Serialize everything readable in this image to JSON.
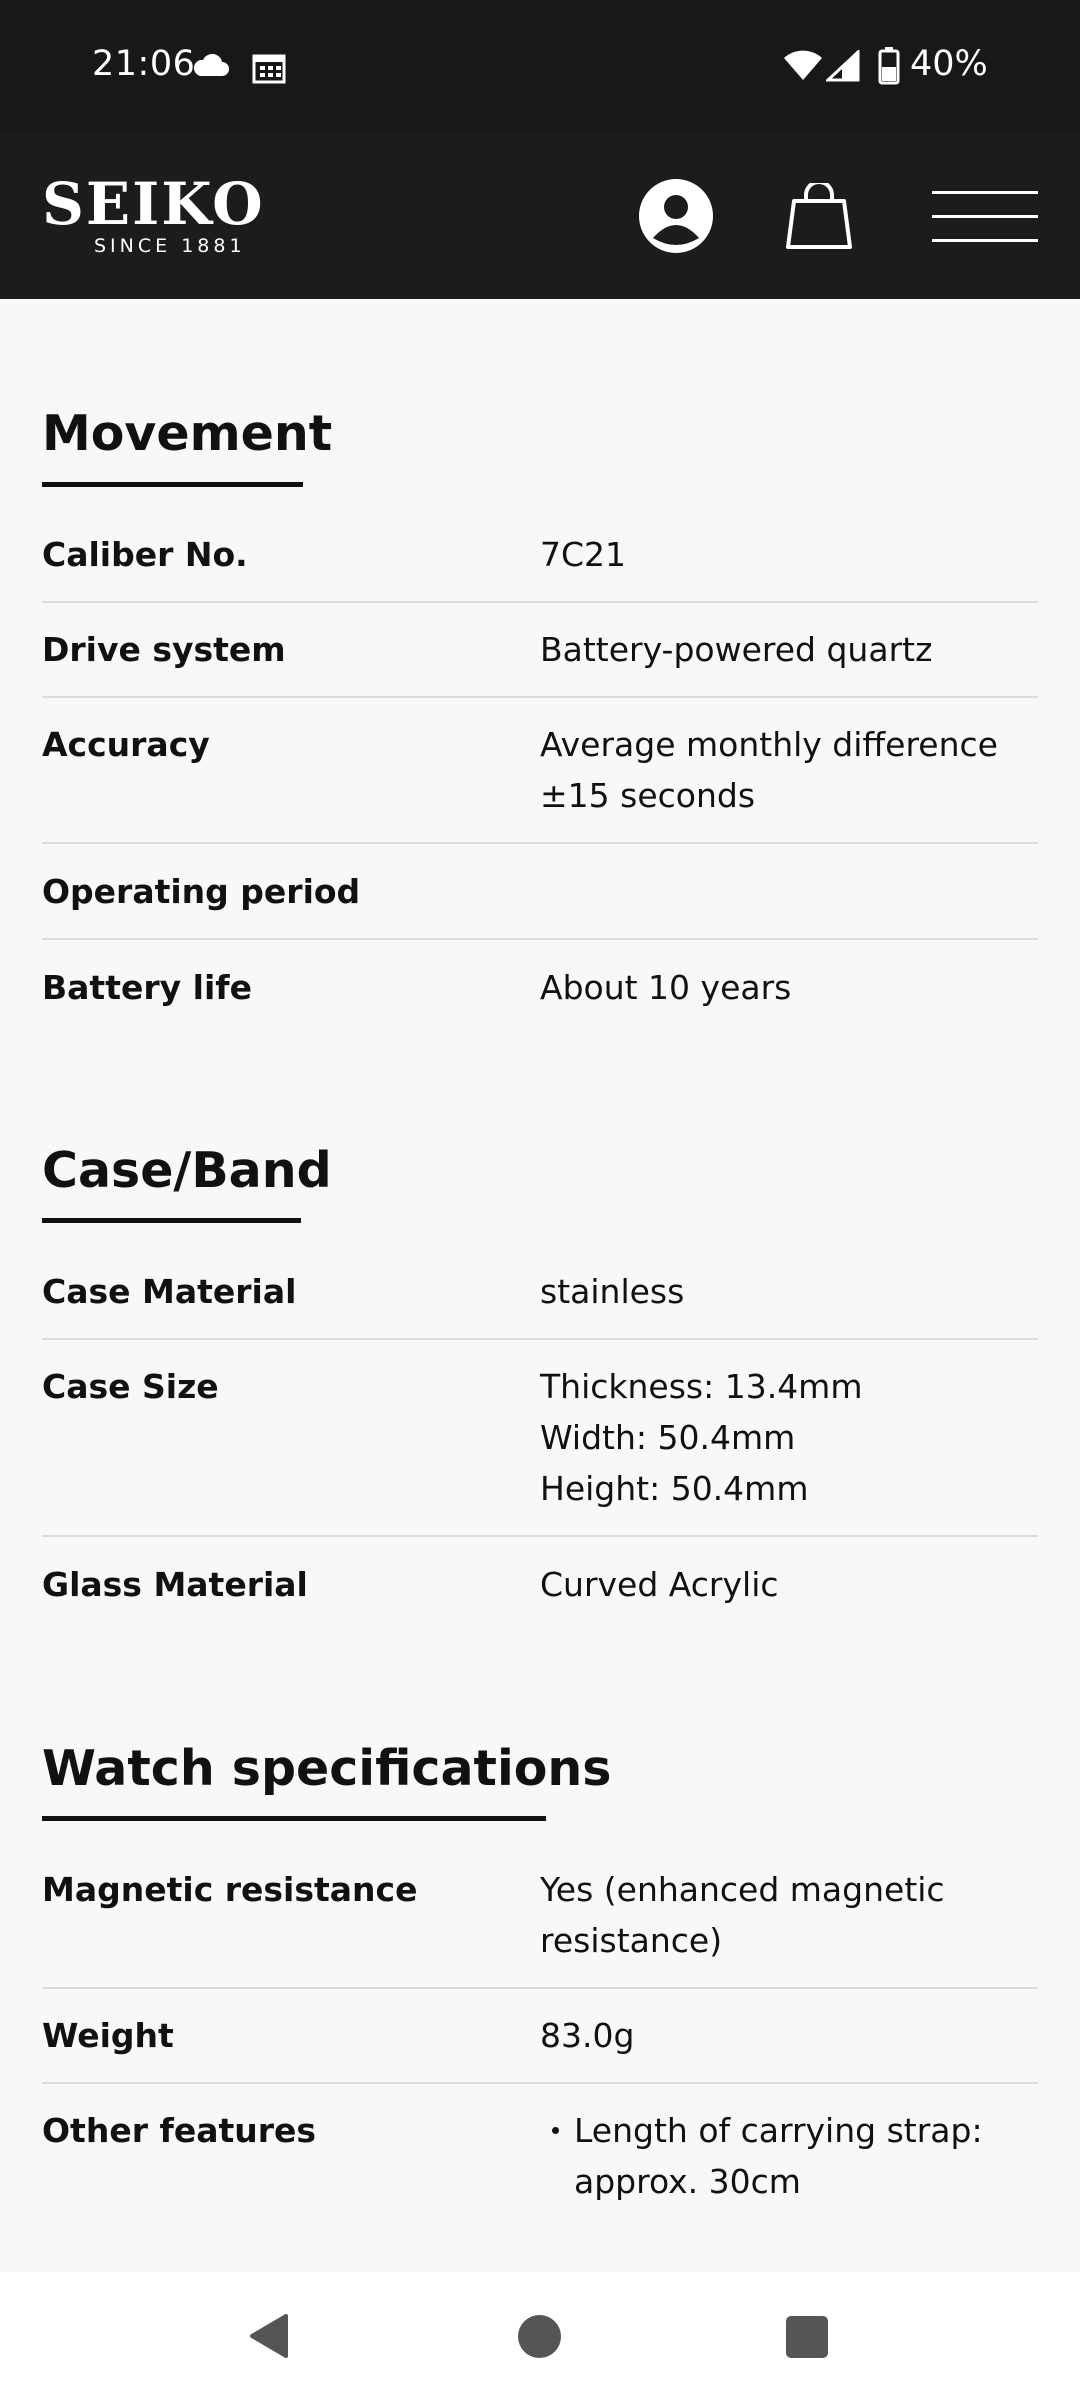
{
  "status_bar": {
    "time": "21:06",
    "battery_percent": "40%",
    "icons": [
      "cloud-icon",
      "calendar-icon",
      "wifi-icon",
      "signal-icon",
      "battery-icon"
    ]
  },
  "header": {
    "logo_text": "SEIKO",
    "logo_tagline": "SINCE 1881",
    "icons": [
      "account-icon",
      "shopping-bag-icon",
      "hamburger-menu-icon"
    ]
  },
  "sections": {
    "movement": {
      "title": "Movement",
      "rows": [
        {
          "label": "Caliber No.",
          "value": [
            "7C21"
          ]
        },
        {
          "label": "Drive system",
          "value": [
            "Battery-powered quartz"
          ]
        },
        {
          "label": "Accuracy",
          "value": [
            "Average monthly difference",
            "±15 seconds"
          ]
        },
        {
          "label": "Operating period",
          "value": []
        },
        {
          "label": "Battery life",
          "value": [
            "About 10 years"
          ]
        }
      ]
    },
    "case_band": {
      "title": "Case/Band",
      "rows": [
        {
          "label": "Case Material",
          "value": [
            "stainless"
          ]
        },
        {
          "label": "Case Size",
          "value": [
            "Thickness: 13.4mm",
            "Width: 50.4mm",
            "Height: 50.4mm"
          ]
        },
        {
          "label": "Glass Material",
          "value": [
            "Curved Acrylic"
          ]
        }
      ]
    },
    "watch_specs": {
      "title": "Watch specifications",
      "rows": [
        {
          "label": "Magnetic resistance",
          "value": [
            "Yes (enhanced magnetic",
            "resistance)"
          ]
        },
        {
          "label": "Weight",
          "value": [
            "83.0g"
          ]
        },
        {
          "label": "Other features",
          "bullets": [
            "Length of carrying strap:",
            "approx. 30cm"
          ]
        }
      ]
    }
  },
  "nav_bar": {
    "icons": [
      "back-icon",
      "home-icon",
      "recents-icon"
    ]
  }
}
